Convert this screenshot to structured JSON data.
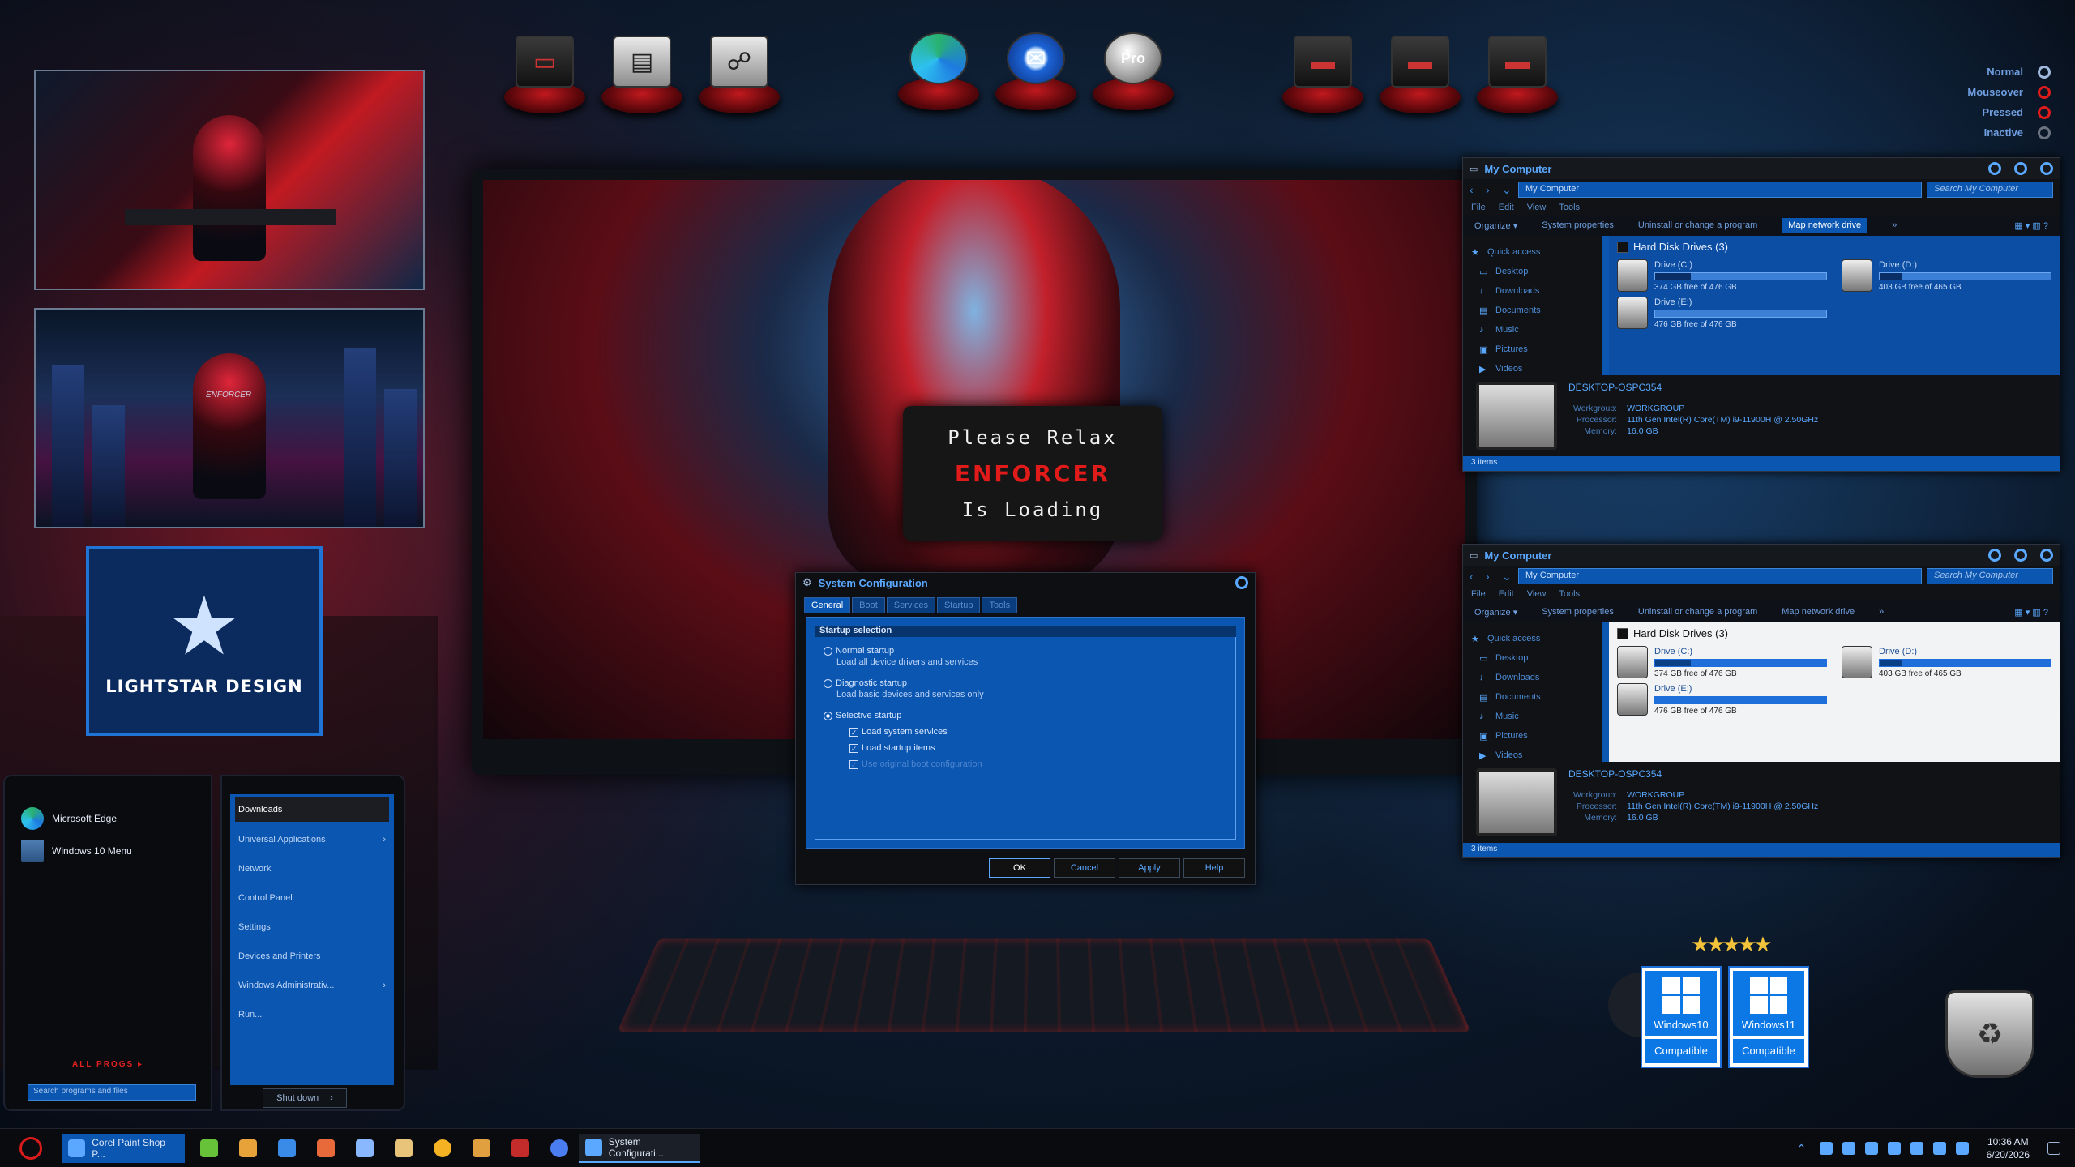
{
  "legend": [
    {
      "label": "Normal",
      "color": "#9fb8dc"
    },
    {
      "label": "Mouseover",
      "color": "#e11a1a"
    },
    {
      "label": "Pressed",
      "color": "#e11a1a"
    },
    {
      "label": "Inactive",
      "color": "#6b7280"
    }
  ],
  "dock": {
    "pro_label": "Pro"
  },
  "logo": {
    "text": "LIGHTSTAR DESIGN"
  },
  "loader": {
    "line1": "Please Relax",
    "line2": "ENFORCER",
    "line3": "Is Loading"
  },
  "thumb": {
    "enforcer_text": "ENFORCER"
  },
  "explorer": {
    "title": "My Computer",
    "address": "My Computer",
    "search_placeholder": "Search My Computer",
    "menu": [
      "File",
      "Edit",
      "View",
      "Tools"
    ],
    "commands": [
      "Organize",
      "System properties",
      "Uninstall or change a program",
      "Map network drive"
    ],
    "organize_label": "Organize ▾",
    "more": "»",
    "nav": [
      "Quick access",
      "Desktop",
      "Downloads",
      "Documents",
      "Music",
      "Pictures",
      "Videos"
    ],
    "section": "Hard Disk Drives (3)",
    "drives": [
      {
        "name": "Drive (C:)",
        "free": "374 GB free of 476 GB",
        "used_fraction": 0.21
      },
      {
        "name": "Drive (D:)",
        "free": "403 GB free of 465 GB",
        "used_fraction": 0.13
      },
      {
        "name": "Drive (E:)",
        "free": "476 GB free of 476 GB",
        "used_fraction": 0.0
      }
    ],
    "computer_name": "DESKTOP-OSPC354",
    "details": [
      {
        "k": "Workgroup:",
        "v": "WORKGROUP"
      },
      {
        "k": "Processor:",
        "v": "11th Gen Intel(R) Core(TM) i9-11900H @ 2.50GHz"
      },
      {
        "k": "Memory:",
        "v": "16.0 GB"
      }
    ],
    "status": "3 items"
  },
  "syscfg": {
    "title": "System Configuration",
    "tabs": [
      "General",
      "Boot",
      "Services",
      "Startup",
      "Tools"
    ],
    "group_title": "Startup selection",
    "options": [
      {
        "label": "Normal startup",
        "desc": "Load all device drivers and services"
      },
      {
        "label": "Diagnostic startup",
        "desc": "Load basic devices and services only"
      },
      {
        "label": "Selective startup",
        "desc": ""
      }
    ],
    "checks": [
      "Load system services",
      "Load startup items",
      "Use original boot configuration"
    ],
    "buttons": [
      "OK",
      "Cancel",
      "Apply",
      "Help"
    ]
  },
  "start": {
    "pinned": [
      "Microsoft Edge",
      "Windows 10 Menu"
    ],
    "all_programs": "ALL PROGS ▸",
    "search_placeholder": "Search programs and files",
    "right_items": [
      "Downloads",
      "Universal Applications",
      "Network",
      "Control Panel",
      "Settings",
      "Devices and Printers",
      "Windows Administrativ...",
      "Run..."
    ],
    "shutdown": "Shut down",
    "shutdown_arrow": "›"
  },
  "badges": [
    {
      "name": "Windows10",
      "label": "Compatible"
    },
    {
      "name": "Windows11",
      "label": "Compatible"
    }
  ],
  "taskbar": {
    "apps": [
      "Corel Paint Shop P...",
      "System Configurati..."
    ],
    "time": "10:36 AM",
    "date": "6/20/2026"
  }
}
